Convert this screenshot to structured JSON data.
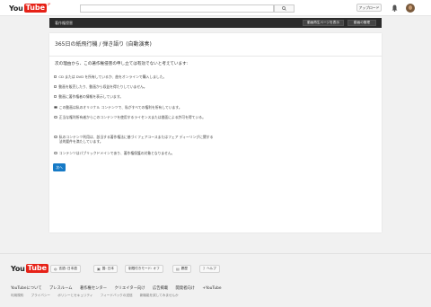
{
  "header": {
    "logo": {
      "you": "You",
      "tube": "Tube",
      "region": "JP"
    },
    "search_placeholder": "",
    "upload_label": "アップロード"
  },
  "subbar": {
    "title": "著作権侵害",
    "watch_page_label": "動画再生ページを表示",
    "manage_videos_label": "動画の管理"
  },
  "video": {
    "title": "365日の紙飛行機 / 弾き語り (自動演奏)"
  },
  "form": {
    "question": "次の理由から、この著作権侵害の申し立ては有効でないと考えています:",
    "options": [
      {
        "label": "CD または DVD を所有しているか、曲をオンラインで購入しました。",
        "type": "checkbox",
        "checked": false
      },
      {
        "label": "動画を販売したり、動画から収益を得たりしていません。",
        "type": "checkbox",
        "checked": false
      },
      {
        "label": "動画に著作権者の情報を表示しています。",
        "type": "checkbox",
        "checked": false
      },
      {
        "label": "この動画は私のオリジナル コンテンツで、私がすべての権利を所有しています。",
        "type": "radio",
        "checked": true
      },
      {
        "label": "正当な権利所有者からこのコンテンツを使用するライセンスまたは書面による許可を得ている。",
        "type": "radio",
        "checked": false
      },
      {
        "label": "私のコンテンツ利用は、該当する著作権法に基づくフェアユースまたはフェア ディーリングに関する法的要件を満たしています。",
        "type": "radio",
        "checked": false
      },
      {
        "label": "コンテンツはパブリックドメインであり、著作権保護の対象となりません。",
        "type": "radio",
        "checked": false
      }
    ],
    "next_label": "次へ"
  },
  "footer": {
    "language_label": "言語: 日本語",
    "country_label": "国: 日本",
    "restricted_label": "制限付きモード: オフ",
    "history_label": "履歴",
    "help_label": "ヘルプ",
    "links": [
      "YouTubeについて",
      "プレスルーム",
      "著作権センター",
      "クリエイター向け",
      "広告掲載",
      "開発者向け",
      "+YouTube"
    ],
    "small_links": [
      "利用規約",
      "プライバシー",
      "ポリシーとセキュリティ",
      "フィードバックの送信",
      "新機能を試してみませんか"
    ]
  },
  "colors": {
    "accent": "#167ac6",
    "brand": "#e62117",
    "subbar": "#2b2b2b"
  }
}
